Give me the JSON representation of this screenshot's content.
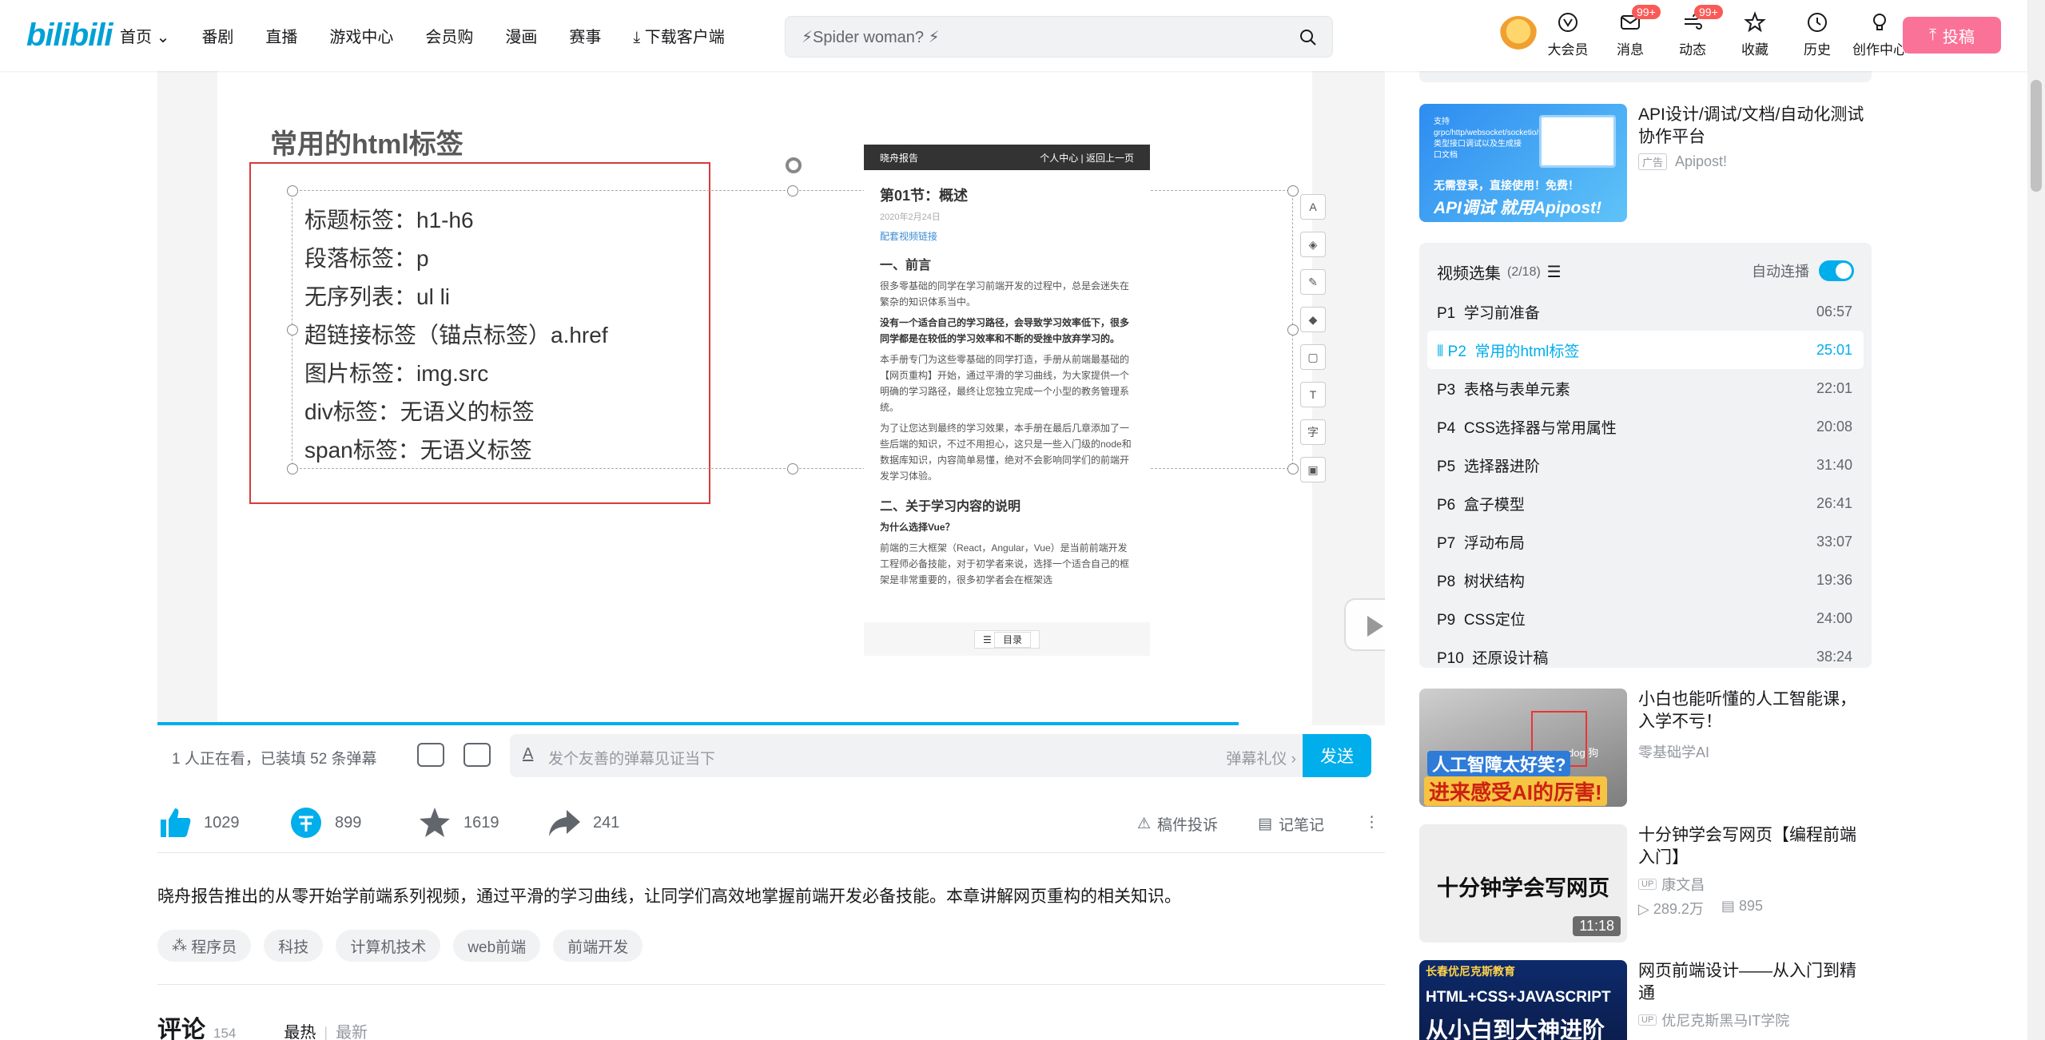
{
  "header": {
    "logo": "bilibili",
    "nav": [
      "首页",
      "番剧",
      "直播",
      "游戏中心",
      "会员购",
      "漫画",
      "赛事",
      "下载客户端"
    ],
    "search_placeholder": "⚡Spider woman? ⚡",
    "icons": [
      {
        "label": "大会员",
        "badge": ""
      },
      {
        "label": "消息",
        "badge": "99+"
      },
      {
        "label": "动态",
        "badge": "99+"
      },
      {
        "label": "收藏",
        "badge": ""
      },
      {
        "label": "历史",
        "badge": ""
      },
      {
        "label": "创作中心",
        "badge": ""
      }
    ],
    "upload": "投稿"
  },
  "video": {
    "slide_title": "常用的html标签",
    "tags": [
      "标题标签：h1-h6",
      "段落标签：p",
      "无序列表：ul li",
      "超链接标签（锚点标签）a.href",
      "图片标签：img.src",
      "div标签：无语义的标签",
      "span标签：无语义标签"
    ],
    "doc": {
      "bar_left": "晓舟报告",
      "bar_right": "个人中心 | 返回上一页",
      "heading": "第01节：概述",
      "date": "2020年2月24日",
      "link": "配套视频链接",
      "sec1": "一、前言",
      "p1": "很多零基础的同学在学习前端开发的过程中，总是会迷失在繁杂的知识体系当中。",
      "p2": "没有一个适合自己的学习路径，会导致学习效率低下，很多同学都是在较低的学习效率和不断的受挫中放弃学习的。",
      "p3": "本手册专门为这些零基础的同学打造，手册从前端最基础的【网页重构】开始，通过平滑的学习曲线，为大家提供一个明确的学习路径，最终让您独立完成一个小型的教务管理系统。",
      "p4": "为了让您达到最终的学习效果，本手册在最后几章添加了一些后端的知识，不过不用担心，这只是一些入门级的node和数据库知识，内容简单易懂，绝对不会影响同学们的前端开发学习体验。",
      "sec2": "二、关于学习内容的说明",
      "sub": "为什么选择Vue？",
      "p5": "前端的三大框架（React，Angular，Vue）是当前前端开发工程师必备技能，对于初学者来说，选择一个适合自己的框架是非常重要的，很多初学者会在框架选",
      "toc": "目录"
    }
  },
  "danmaku": {
    "viewers": "1 人正在看，已装填 52 条弹幕",
    "placeholder": "发个友善的弹幕见证当下",
    "etiquette": "弹幕礼仪 ›",
    "send": "发送"
  },
  "actions": {
    "like": "1029",
    "coin": "899",
    "fav": "1619",
    "share": "241",
    "report": "稿件投诉",
    "note": "记笔记"
  },
  "description": "晓舟报告推出的从零开始学前端系列视频，通过平滑的学习曲线，让同学们高效地掌握前端开发必备技能。本章讲解网页重构的相关知识。",
  "video_tags": [
    "程序员",
    "科技",
    "计算机技术",
    "web前端",
    "前端开发"
  ],
  "comments": {
    "title": "评论",
    "count": "154",
    "sort_hot": "最热",
    "sort_new": "最新"
  },
  "ad": {
    "title": "API设计/调试/文档/自动化测试协作平台",
    "tag": "广告",
    "brand": "Apipost!",
    "img_text1": "支持grpc/http/websocket/socketio/socketjs类型接口调试以及生成接口文档",
    "img_text2": "无需登录，直接使用！免费！",
    "img_text3": "API调试 就用Apipost!"
  },
  "playlist": {
    "title": "视频选集",
    "count": "(2/18)",
    "auto": "自动连播",
    "items": [
      {
        "p": "P1",
        "title": "学习前准备",
        "dur": "06:57"
      },
      {
        "p": "P2",
        "title": "常用的html标签",
        "dur": "25:01"
      },
      {
        "p": "P3",
        "title": "表格与表单元素",
        "dur": "22:01"
      },
      {
        "p": "P4",
        "title": "CSS选择器与常用属性",
        "dur": "20:08"
      },
      {
        "p": "P5",
        "title": "选择器进阶",
        "dur": "31:40"
      },
      {
        "p": "P6",
        "title": "盒子模型",
        "dur": "26:41"
      },
      {
        "p": "P7",
        "title": "浮动布局",
        "dur": "33:07"
      },
      {
        "p": "P8",
        "title": "树状结构",
        "dur": "19:36"
      },
      {
        "p": "P9",
        "title": "CSS定位",
        "dur": "24:00"
      },
      {
        "p": "P10",
        "title": "还原设计稿",
        "dur": "38:24"
      }
    ]
  },
  "recs": [
    {
      "title": "小白也能听懂的人工智能课，入学不亏！",
      "up": "零基础学AI",
      "thumb1": "人工智障太好笑?",
      "thumb2": "进来感受AI的厉害!",
      "thumb3": "dog 狗",
      "views": "",
      "danmaku": "",
      "dur": ""
    },
    {
      "title": "十分钟学会写网页【编程前端入门】",
      "up": "康文昌",
      "thumb1": "十分钟学会写网页",
      "views": "289.2万",
      "danmaku": "895",
      "dur": "11:18"
    },
    {
      "title": "网页前端设计——从入门到精通",
      "up": "优尼克斯黑马IT学院",
      "thumb1": "长春优尼克斯教育",
      "thumb2": "HTML+CSS+JAVASCRIPT",
      "thumb3": "从小白到大神进阶"
    }
  ]
}
